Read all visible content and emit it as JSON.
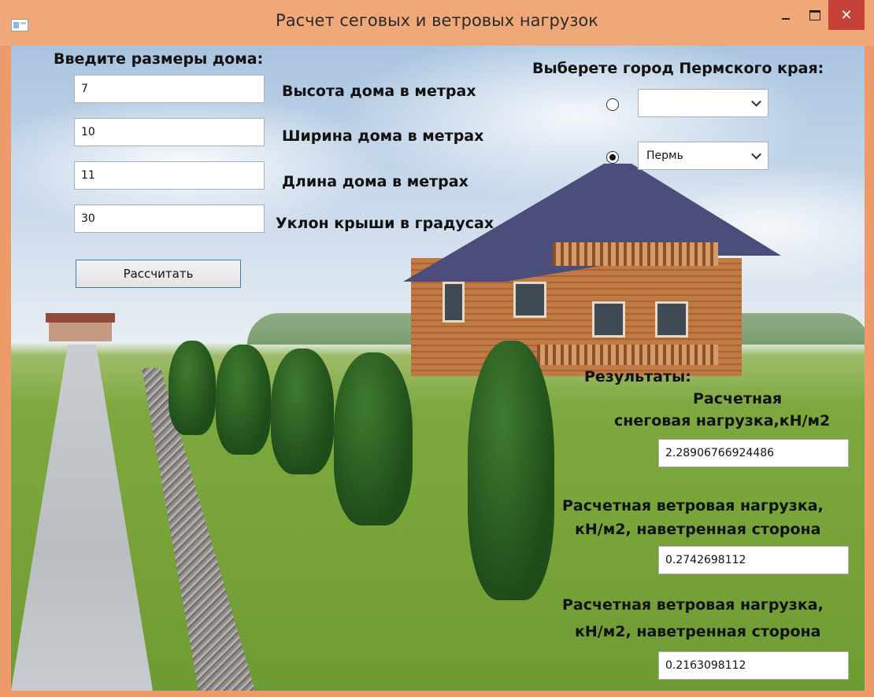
{
  "window": {
    "title": "Расчет сеговых и ветровых нагрузок",
    "close_glyph": "✕"
  },
  "inputs_section": {
    "heading": "Введите размеры дома:",
    "fields": [
      {
        "value": "7",
        "label": "Высота дома в метрах"
      },
      {
        "value": "10",
        "label": "Ширина дома в метрах"
      },
      {
        "value": "11",
        "label": "Длина дома в метрах"
      },
      {
        "value": "30",
        "label": "Уклон крыши в градусах"
      }
    ],
    "calculate_label": "Рассчитать"
  },
  "city_section": {
    "heading": "Выберете город Пермского края:",
    "options": [
      {
        "selected": false,
        "value": ""
      },
      {
        "selected": true,
        "value": "Пермь"
      }
    ]
  },
  "results": {
    "heading": "Результаты:",
    "snow_label_1": "Расчетная",
    "snow_label_2": "снеговая нагрузка,кН/м2",
    "snow_value": "2.28906766924486",
    "wind1_label_1": "Расчетная ветровая нагрузка,",
    "wind1_label_2": "кН/м2, наветренная сторона",
    "wind1_value": "0.2742698112",
    "wind2_label_1": "Расчетная ветровая нагрузка,",
    "wind2_label_2": "кН/м2, наветренная сторона",
    "wind2_value": "0.2163098112"
  },
  "colors": {
    "titlebar": "#f0a878",
    "close": "#c7413b",
    "button_border": "#3c7fb1"
  },
  "icons": [
    "app-icon",
    "minimize-icon",
    "maximize-icon",
    "close-icon",
    "chevron-down-icon"
  ]
}
